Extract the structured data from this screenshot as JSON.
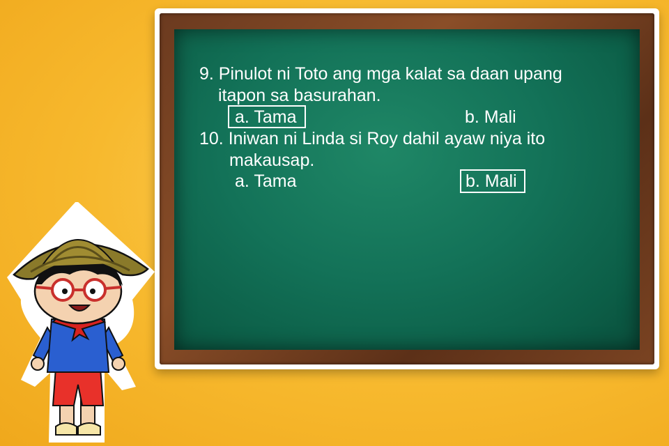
{
  "questions": [
    {
      "line1": "9. Pinulot ni Toto ang mga kalat sa daan upang",
      "line2": "itapon sa basurahan.",
      "option_a": "a. Tama",
      "option_b": "b. Mali",
      "selected": "a"
    },
    {
      "line1": "10. Iniwan ni Linda si Roy dahil ayaw niya ito",
      "line2": "makausap.",
      "option_a": "a. Tama",
      "option_b": "b. Mali",
      "selected": "b"
    }
  ],
  "colors": {
    "background": "#f7b92e",
    "board_green": "#137258",
    "frame_brown": "#6b3a1f",
    "chalk_text": "#ffffff"
  },
  "icons": [
    "chalkboard-icon",
    "boy-with-salakot-illustration"
  ]
}
